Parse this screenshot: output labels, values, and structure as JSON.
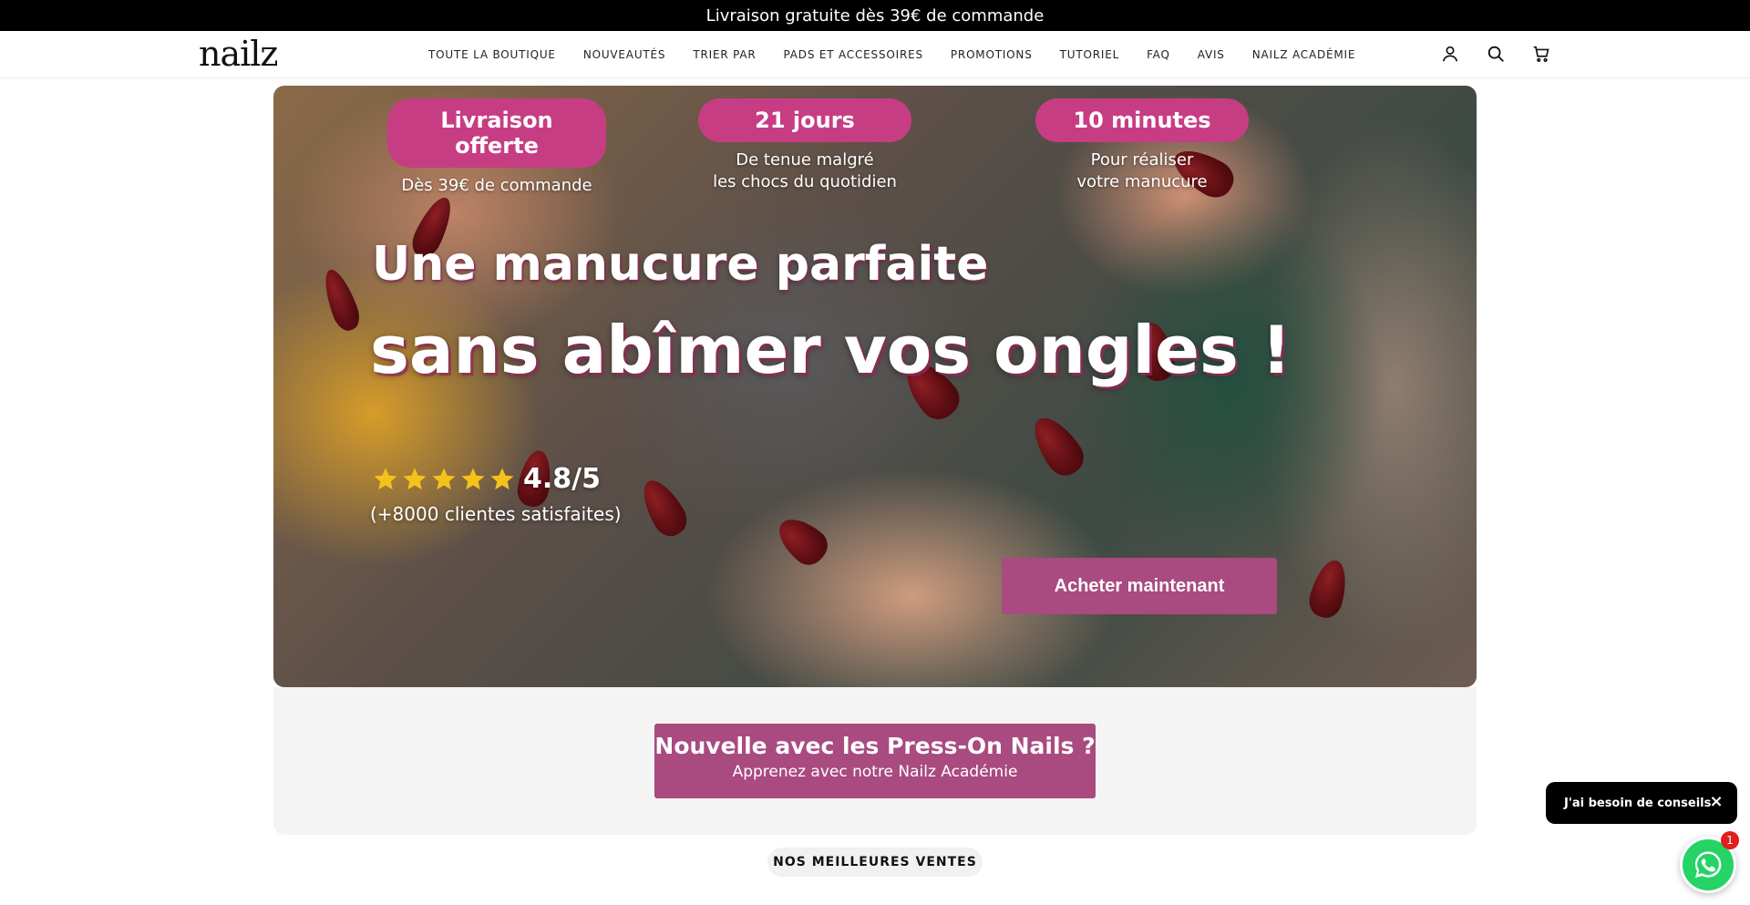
{
  "announcement": {
    "text": "Livraison gratuite dès 39€ de commande"
  },
  "header": {
    "logo": "nailz",
    "nav": [
      {
        "label": "TOUTE LA BOUTIQUE"
      },
      {
        "label": "NOUVEAUTÉS"
      },
      {
        "label": "TRIER PAR"
      },
      {
        "label": "PADS ET ACCESSOIRES"
      },
      {
        "label": "PROMOTIONS"
      },
      {
        "label": "TUTORIEL"
      },
      {
        "label": "FAQ"
      },
      {
        "label": "AVIS"
      },
      {
        "label": "NAILZ ACADÉMIE"
      }
    ],
    "icons": [
      "account-icon",
      "search-icon",
      "cart-icon"
    ]
  },
  "hero": {
    "badges": [
      {
        "title": "Livraison offerte",
        "sub1": "Dès 39€ de commande",
        "sub2": ""
      },
      {
        "title": "21 jours",
        "sub1": "De tenue malgré",
        "sub2": "les chocs du quotidien"
      },
      {
        "title": "10 minutes",
        "sub1": "Pour réaliser",
        "sub2": "votre manucure"
      }
    ],
    "title_line1": "Une manucure parfaite",
    "title_line2": "sans abîmer vos ongles !",
    "rating": {
      "stars": 5,
      "value": "4.8/5",
      "sub": "(+8000 clientes satisfaites)"
    },
    "cta": "Acheter maintenant"
  },
  "academy": {
    "title": "Nouvelle avec les Press-On Nails ?",
    "sub": "Apprenez avec notre Nailz Académie"
  },
  "best_sellers": {
    "label": "NOS MEILLEURES VENTES"
  },
  "chat": {
    "bubble": "J'ai besoin de conseils",
    "close": "×",
    "badge": "1"
  },
  "colors": {
    "accent": "#c73d83",
    "button": "#a94a80",
    "whatsapp": "#25d366"
  }
}
